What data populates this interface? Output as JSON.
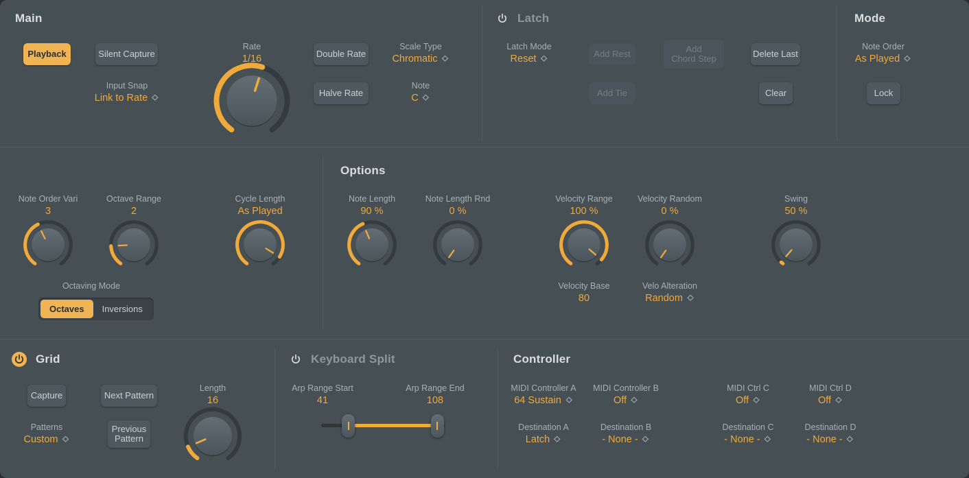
{
  "theme": {
    "background": "#454f54",
    "accent": "#f0a93b",
    "accent_button": "#f0b455",
    "label": "#a7b0b6",
    "title": "#d9dde0",
    "button_bg": "#4e585e"
  },
  "sections": {
    "main": {
      "title": "Main"
    },
    "latch": {
      "title": "Latch",
      "power": "off",
      "power_icon": "power-icon"
    },
    "mode": {
      "title": "Mode"
    },
    "options": {
      "title": "Options"
    },
    "grid": {
      "title": "Grid",
      "power": "on",
      "power_icon": "power-icon"
    },
    "keyboard_split": {
      "title": "Keyboard Split",
      "power": "off",
      "power_icon": "power-icon"
    },
    "controller": {
      "title": "Controller"
    }
  },
  "main": {
    "playback_button": "Playback",
    "silent_capture_button": "Silent Capture",
    "input_snap": {
      "label": "Input Snap",
      "value": "Link to Rate",
      "icon": "chevron-updown-icon"
    },
    "rate": {
      "label": "Rate",
      "value": "1/16",
      "knob_pct": 56
    },
    "double_rate_button": "Double Rate",
    "halve_rate_button": "Halve Rate",
    "scale_type": {
      "label": "Scale Type",
      "value": "Chromatic",
      "icon": "chevron-updown-icon"
    },
    "note": {
      "label": "Note",
      "value": "C",
      "icon": "chevron-updown-icon"
    }
  },
  "latch": {
    "latch_mode": {
      "label": "Latch Mode",
      "value": "Reset",
      "icon": "chevron-updown-icon"
    },
    "add_rest_button": "Add Rest",
    "add_tie_button": "Add Tie",
    "add_chord_step_button": "Add\nChord Step",
    "delete_last_button": "Delete Last",
    "clear_button": "Clear"
  },
  "mode": {
    "note_order": {
      "label": "Note Order",
      "value": "As Played",
      "icon": "chevron-updown-icon"
    },
    "lock_button": "Lock"
  },
  "options": {
    "note_order_vari": {
      "label": "Note Order Vari",
      "value": "3",
      "knob_pct": 41
    },
    "octave_range": {
      "label": "Octave Range",
      "value": "2",
      "knob_pct": 18
    },
    "octaving_mode": {
      "label": "Octaving Mode",
      "options": [
        "Octaves",
        "Inversions"
      ],
      "selected": "Octaves"
    },
    "cycle_length": {
      "label": "Cycle Length",
      "value": "As Played",
      "knob_pct": 92
    },
    "note_length": {
      "label": "Note Length",
      "value": "90 %",
      "knob_pct": 42
    },
    "note_length_rnd": {
      "label": "Note Length Rnd",
      "value": "0 %",
      "knob_pct": 0
    },
    "velocity_range": {
      "label": "Velocity Range",
      "value": "100 %",
      "knob_pct": 95
    },
    "velocity_base": {
      "label": "Velocity Base",
      "value": "80"
    },
    "velocity_random": {
      "label": "Velocity Random",
      "value": "0 %",
      "knob_pct": 0
    },
    "velo_alteration": {
      "label": "Velo Alteration",
      "value": "Random",
      "icon": "chevron-updown-icon"
    },
    "swing": {
      "label": "Swing",
      "value": "50 %",
      "knob_pct": 2
    }
  },
  "grid": {
    "capture_button": "Capture",
    "next_pattern_button": "Next Pattern",
    "previous_pattern_button": "Previous\nPattern",
    "patterns": {
      "label": "Patterns",
      "value": "Custom",
      "icon": "chevron-updown-icon"
    },
    "length": {
      "label": "Length",
      "value": "16",
      "knob_pct": 11
    }
  },
  "keyboard_split": {
    "arp_range_start": {
      "label": "Arp Range Start",
      "value": "41"
    },
    "arp_range_end": {
      "label": "Arp Range End",
      "value": "108"
    },
    "slider": {
      "start_pct": 22,
      "end_pct": 94
    }
  },
  "controller": {
    "rows": [
      {
        "ctrl_label": "MIDI Controller A",
        "ctrl_value": "64 Sustain",
        "dest_label": "Destination A",
        "dest_value": "Latch",
        "icon": "chevron-updown-icon"
      },
      {
        "ctrl_label": "MIDI Controller B",
        "ctrl_value": "Off",
        "dest_label": "Destination B",
        "dest_value": "- None -",
        "icon": "chevron-updown-icon"
      },
      {
        "ctrl_label": "MIDI Ctrl C",
        "ctrl_value": "Off",
        "dest_label": "Destination C",
        "dest_value": "- None -",
        "icon": "chevron-updown-icon"
      },
      {
        "ctrl_label": "MIDI Ctrl D",
        "ctrl_value": "Off",
        "dest_label": "Destination D",
        "dest_value": "- None -",
        "icon": "chevron-updown-icon"
      }
    ]
  }
}
